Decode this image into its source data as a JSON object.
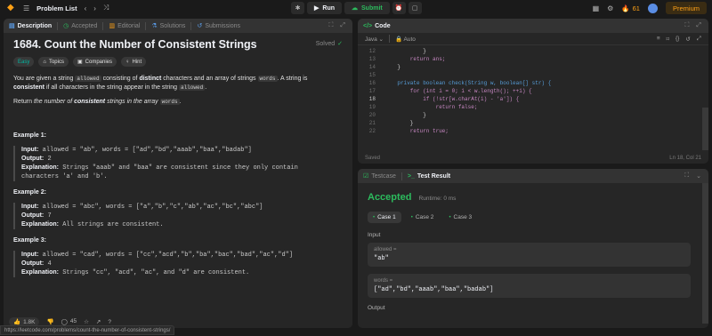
{
  "topbar": {
    "problem_list": "Problem List",
    "run": "Run",
    "submit": "Submit",
    "streak": "61",
    "premium": "Premium"
  },
  "left_tabs": [
    "Description",
    "Accepted",
    "Editorial",
    "Solutions",
    "Submissions"
  ],
  "problem": {
    "title": "1684. Count the Number of Consistent Strings",
    "status": "Solved",
    "chips": [
      "Easy",
      "Topics",
      "Companies",
      "Hint"
    ],
    "para1_a": "You are given a string ",
    "para1_code1": "allowed",
    "para1_b": " consisting of ",
    "para1_bold1": "distinct",
    "para1_c": " characters and an array of strings ",
    "para1_code2": "words",
    "para1_d": ". A string is",
    "para1_bold2": "consistent",
    "para1_e": " if all characters in the string appear in the string ",
    "para1_code3": "allowed",
    "para1_f": ".",
    "para2_a": "Return ",
    "para2_i1": "the number of ",
    "para2_bold": "consistent",
    "para2_i2": " strings in the array ",
    "para2_code": "words",
    "para2_end": "."
  },
  "examples": [
    {
      "heading": "Example 1:",
      "input_label": "Input:",
      "input": "allowed = \"ab\", words = [\"ad\",\"bd\",\"aaab\",\"baa\",\"badab\"]",
      "output_label": "Output:",
      "output": "2",
      "explanation_label": "Explanation:",
      "explanation": "Strings \"aaab\" and \"baa\" are consistent since they only contain",
      "explanation2": "characters 'a' and 'b'."
    },
    {
      "heading": "Example 2:",
      "input_label": "Input:",
      "input": "allowed = \"abc\", words = [\"a\",\"b\",\"c\",\"ab\",\"ac\",\"bc\",\"abc\"]",
      "output_label": "Output:",
      "output": "7",
      "explanation_label": "Explanation:",
      "explanation": "All strings are consistent."
    },
    {
      "heading": "Example 3:",
      "input_label": "Input:",
      "input": "allowed = \"cad\", words = [\"cc\",\"acd\",\"b\",\"ba\",\"bac\",\"bad\",\"ac\",\"d\"]",
      "output_label": "Output:",
      "output": "4",
      "explanation_label": "Explanation:",
      "explanation": "Strings \"cc\", \"acd\", \"ac\", and \"d\" are consistent."
    }
  ],
  "footer": {
    "likes": "1.8K",
    "comments": "45"
  },
  "code_panel": {
    "tab": "Code",
    "language": "Java",
    "mode": "Auto",
    "saved": "Saved",
    "cursor": "Ln 18, Col 21"
  },
  "code_lines": [
    {
      "n": "12",
      "t": "            }"
    },
    {
      "n": "13",
      "t": "        return ans;"
    },
    {
      "n": "14",
      "t": "    }"
    },
    {
      "n": "15",
      "t": ""
    },
    {
      "n": "16",
      "t": "    private boolean check(String w, boolean[] str) {"
    },
    {
      "n": "17",
      "t": "        for (int i = 0; i < w.length(); ++i) {"
    },
    {
      "n": "18",
      "t": "            if (!str[w.charAt(i) - 'a']) {"
    },
    {
      "n": "19",
      "t": "                return false;"
    },
    {
      "n": "20",
      "t": "            }"
    },
    {
      "n": "21",
      "t": "        }"
    },
    {
      "n": "22",
      "t": "        return true;"
    }
  ],
  "result_panel": {
    "tab1": "Testcase",
    "tab2": "Test Result",
    "accepted": "Accepted",
    "runtime": "Runtime: 0 ms",
    "cases": [
      "Case 1",
      "Case 2",
      "Case 3"
    ],
    "input_label": "Input",
    "allowed_key": "allowed =",
    "allowed_val": "\"ab\"",
    "words_key": "words =",
    "words_val": "[\"ad\",\"bd\",\"aaab\",\"baa\",\"badab\"]",
    "output_label": "Output"
  },
  "status_url": "https://leetcode.com/problems/count-the-number-of-consistent-strings/"
}
